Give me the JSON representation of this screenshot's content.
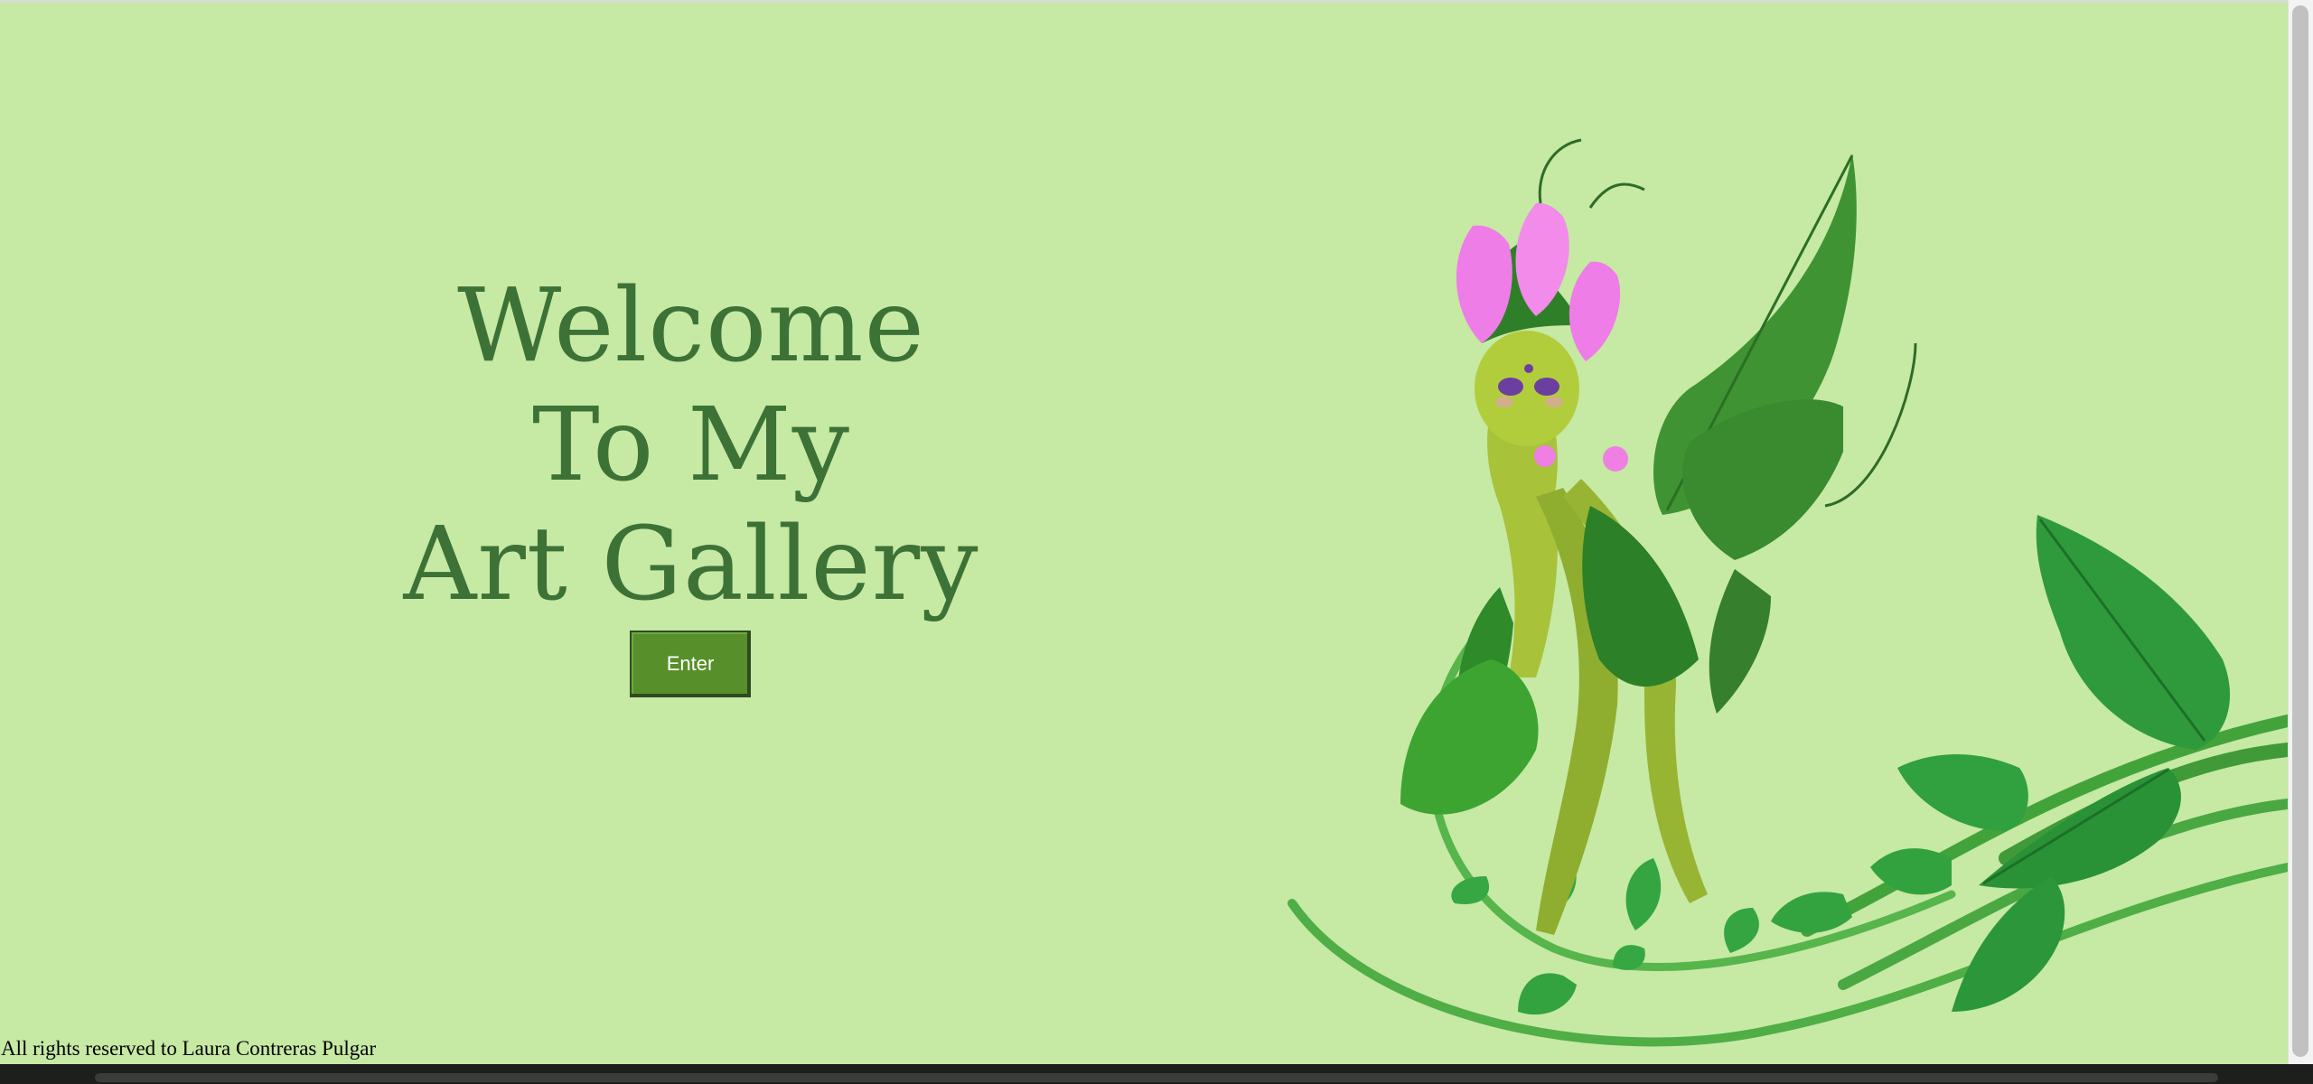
{
  "hero": {
    "heading_line1": "Welcome",
    "heading_line2": "To My",
    "heading_line3": "Art Gallery",
    "enter_label": "Enter"
  },
  "footer": {
    "copyright": "All rights reserved to Laura Contreras Pulgar"
  },
  "colors": {
    "background": "#c6e9a4",
    "heading": "#3d7236",
    "button": "#57902a",
    "leaf_dark": "#2f7d2c",
    "leaf_light": "#4fae45",
    "fairy_body": "#a8c23a",
    "petal": "#ee7de8"
  },
  "illustration": {
    "subject": "leaf-fairy"
  }
}
